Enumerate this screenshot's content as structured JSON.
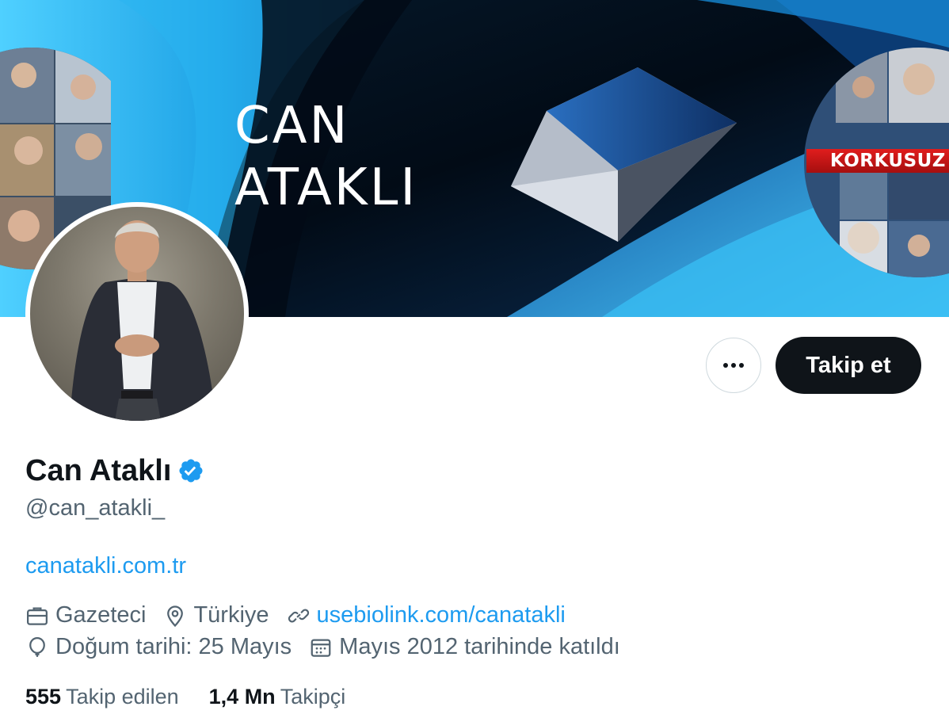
{
  "banner": {
    "title_line1": "CAN",
    "title_line2": "ATAKLI",
    "badge_text": "KORKUSUZ"
  },
  "actions": {
    "more_icon": "more-horizontal-icon",
    "follow_label": "Takip et"
  },
  "profile": {
    "display_name": "Can Ataklı",
    "verified_icon": "verified-badge-icon",
    "handle": "@can_atakli_",
    "bio_link": "canatakli.com.tr"
  },
  "meta": {
    "profession": "Gazeteci",
    "location": "Türkiye",
    "website": "usebiolink.com/canatakli",
    "birthday": "Doğum tarihi: 25 Mayıs",
    "joined": "Mayıs 2012 tarihinde katıldı"
  },
  "stats": {
    "following_count": "555",
    "following_label": "Takip edilen",
    "followers_count": "1,4 Mn",
    "followers_label": "Takipçi"
  },
  "colors": {
    "accent": "#1d9bf0",
    "text_primary": "#0f1419",
    "text_secondary": "#536471",
    "button_dark": "#0f1419",
    "banner_blue": "#29a8e6"
  }
}
